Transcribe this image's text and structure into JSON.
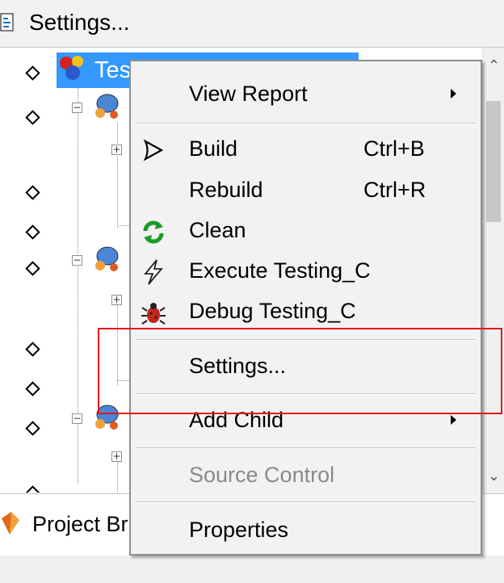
{
  "toolbar": {
    "settings_label": "Settings...",
    "icon": "settings-page-icon"
  },
  "tree": {
    "selected_node_label": "Testing_C",
    "icons": {
      "root": "project-icon",
      "child": "component-icon",
      "marker": "breakpoint-diamond-icon"
    }
  },
  "context_menu": {
    "items": [
      {
        "label": "View Report",
        "has_submenu": true
      },
      {
        "label": "Build",
        "shortcut": "Ctrl+B",
        "icon": "play-outline-icon"
      },
      {
        "label": "Rebuild",
        "shortcut": "Ctrl+R"
      },
      {
        "label": "Clean",
        "icon": "refresh-icon"
      },
      {
        "label": "Execute Testing_C",
        "icon": "lightning-icon"
      },
      {
        "label": "Debug Testing_C",
        "icon": "bug-icon"
      },
      {
        "label": "Settings..."
      },
      {
        "label": "Add Child",
        "has_submenu": true
      },
      {
        "label": "Source Control",
        "disabled": true
      },
      {
        "label": "Properties"
      }
    ]
  },
  "bottom_tab": {
    "label": "Project Br",
    "icon": "project-browser-icon"
  },
  "annotation": {
    "highlight_color": "#e8141a"
  },
  "colors": {
    "selection": "#3399ff",
    "menu_bg": "#f2f2f2"
  }
}
